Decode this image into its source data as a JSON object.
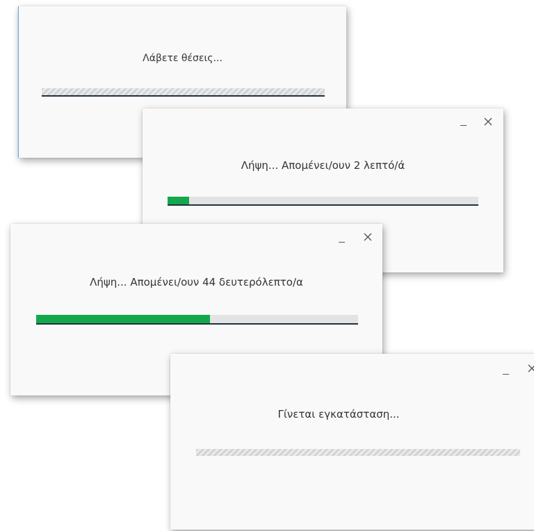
{
  "dialogs": [
    {
      "message": "Λάβετε θέσεις...",
      "progress": {
        "mode": "indeterminate"
      }
    },
    {
      "message": "Λήψη... Απομένει/ουν 2 λεπτό/ά",
      "progress": {
        "mode": "determinate",
        "fraction": 0.07
      },
      "controls": {
        "minimize_icon": "minimize-icon",
        "close_icon": "close-icon"
      }
    },
    {
      "message": "Λήψη... Απομένει/ουν 44 δευτερόλεπτο/α",
      "progress": {
        "mode": "determinate",
        "fraction": 0.54
      },
      "controls": {
        "minimize_icon": "minimize-icon",
        "close_icon": "close-icon"
      }
    },
    {
      "message": "Γίνεται εγκατάσταση...",
      "progress": {
        "mode": "indeterminate"
      },
      "controls": {
        "minimize_icon": "minimize-icon",
        "close_icon": "close-icon"
      }
    }
  ],
  "colors": {
    "progress_fill": "#13a84b",
    "progress_track": "#e3e3e3",
    "dialog_background": "#f9f9f9"
  }
}
